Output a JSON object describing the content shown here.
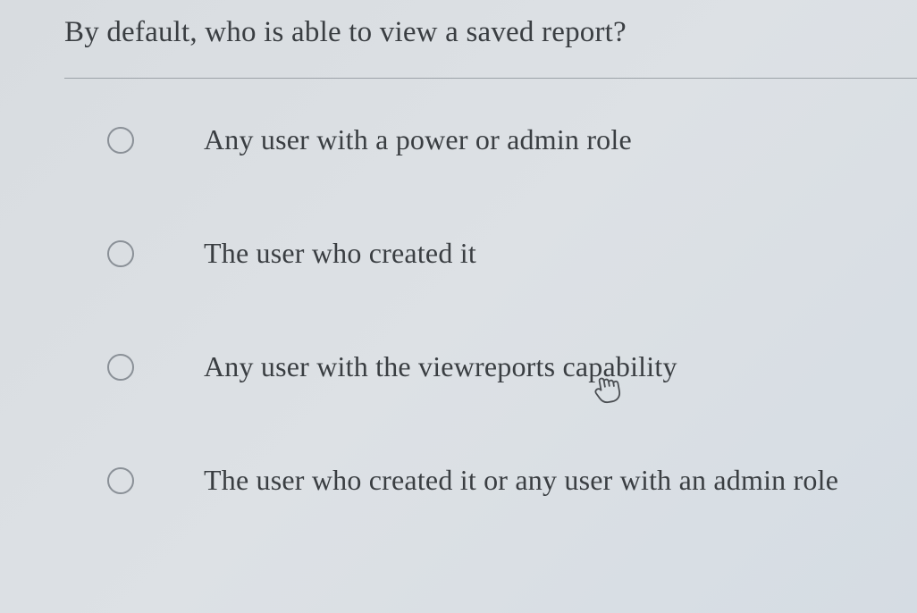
{
  "question": {
    "title": "By default, who is able to view a saved report?",
    "options": [
      {
        "label": "Any user with a power or admin role"
      },
      {
        "label": "The user who created it"
      },
      {
        "label": "Any user with the viewreports capability"
      },
      {
        "label": "The user who created it or any user with an admin role"
      }
    ]
  }
}
